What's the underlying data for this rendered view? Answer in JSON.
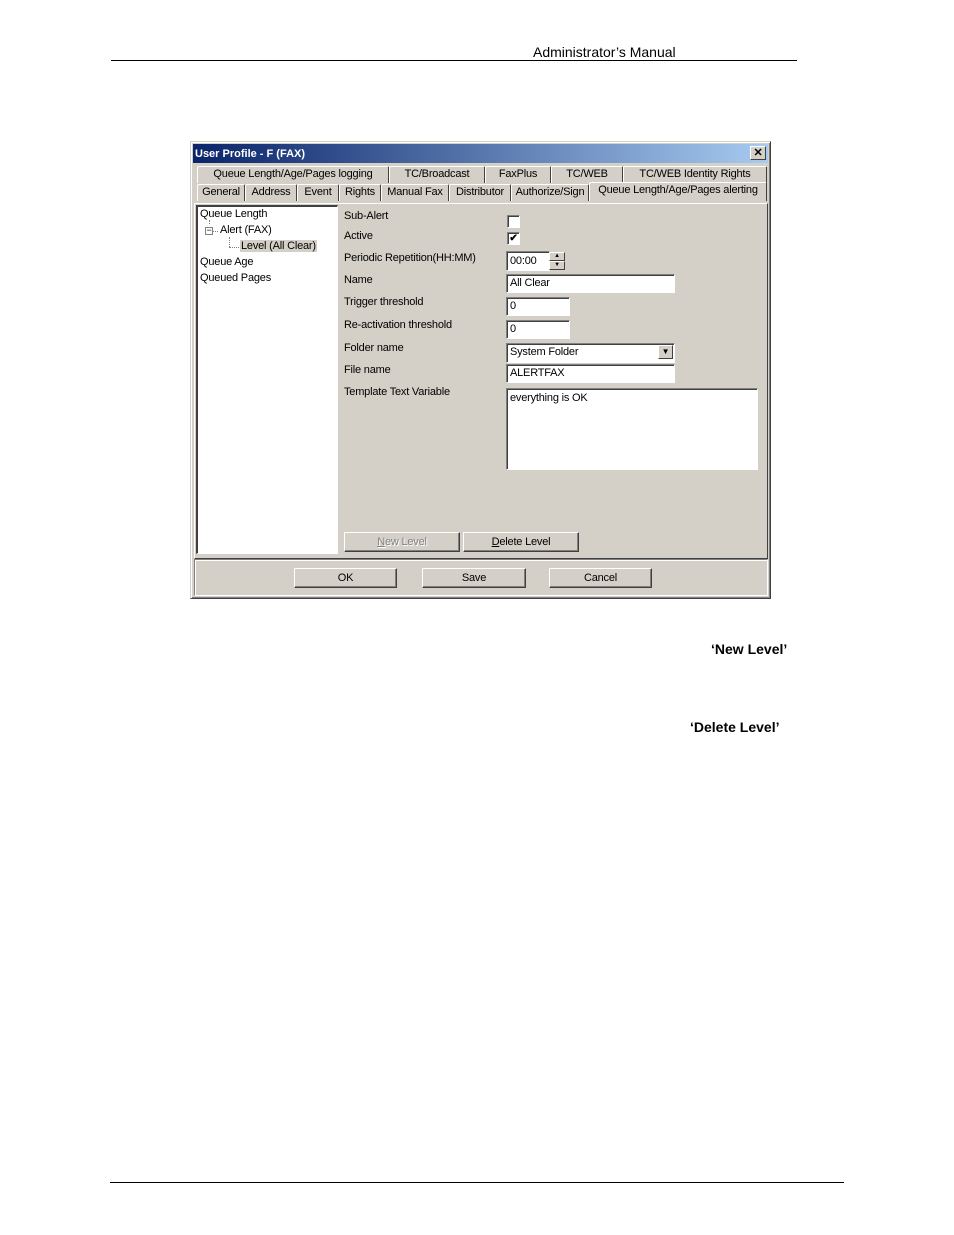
{
  "document": {
    "header_title": "Administrator’s Manual",
    "emphasis_new_level": "‘New Level’",
    "emphasis_delete_level": "‘Delete Level’"
  },
  "dialog": {
    "title": "User Profile - F (FAX)",
    "close_icon": "close-icon",
    "tabs_row1": [
      {
        "label": "Queue Length/Age/Pages logging"
      },
      {
        "label": "TC/Broadcast"
      },
      {
        "label": "FaxPlus"
      },
      {
        "label": "TC/WEB"
      },
      {
        "label": "TC/WEB Identity Rights"
      }
    ],
    "tabs_row2": [
      {
        "label": "General"
      },
      {
        "label": "Address"
      },
      {
        "label": "Event"
      },
      {
        "label": "Rights"
      },
      {
        "label": "Manual Fax"
      },
      {
        "label": "Distributor"
      },
      {
        "label": "Authorize/Sign"
      },
      {
        "label": "Queue Length/Age/Pages alerting",
        "active": true
      }
    ],
    "tree": {
      "items": [
        {
          "label": "Queue Length",
          "level": 0
        },
        {
          "label": "Alert (FAX)",
          "level": 1,
          "expander": "⊟"
        },
        {
          "label": "Level (All Clear)",
          "level": 2,
          "selected": true
        },
        {
          "label": "Queue Age",
          "level": 0
        },
        {
          "label": "Queued Pages",
          "level": 0
        }
      ]
    },
    "form": {
      "sub_alert": {
        "label": "Sub-Alert",
        "checked": false
      },
      "active": {
        "label": "Active",
        "checked": true,
        "check_glyph": "✔"
      },
      "periodic_repetition": {
        "label": "Periodic Repetition(HH:MM)",
        "value": "00:00",
        "up": "▲",
        "down": "▼"
      },
      "name": {
        "label": "Name",
        "value": "All Clear"
      },
      "trigger_threshold": {
        "label": "Trigger threshold",
        "value": "0"
      },
      "reactivation_threshold": {
        "label": "Re-activation threshold",
        "value": "0"
      },
      "folder_name": {
        "label": "Folder name",
        "value": "System Folder",
        "arrow": "▼"
      },
      "file_name": {
        "label": "File name",
        "value": "ALERTFAX"
      },
      "template_text_variable": {
        "label": "Template Text Variable",
        "value": "everything is OK"
      }
    },
    "buttons": {
      "new_level": {
        "mnemonic": "N",
        "rest": "ew Level",
        "disabled": true
      },
      "delete_level": {
        "mnemonic": "D",
        "rest": "elete Level"
      },
      "ok": "OK",
      "save": "Save",
      "cancel": "Cancel"
    }
  }
}
